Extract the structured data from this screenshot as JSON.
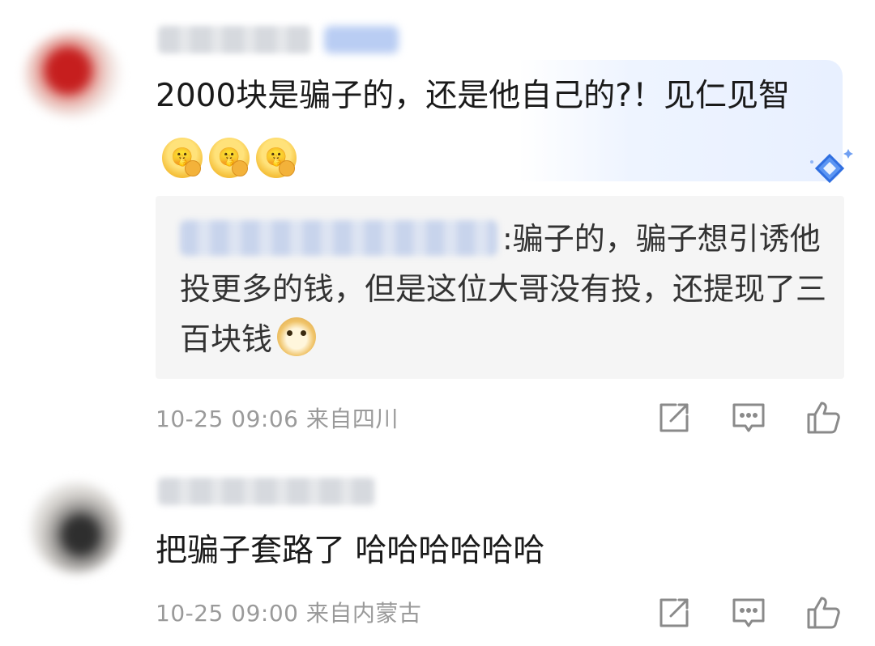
{
  "comments": [
    {
      "username": "",
      "text_main": "2000块是骗子的，还是他自己的?！见仁见智",
      "emojis": [
        "shush-emoji",
        "shush-emoji",
        "shush-emoji"
      ],
      "reply": {
        "author": "",
        "text": ":骗子的，骗子想引诱他投更多的钱，但是这位大哥没有投，还提现了三百块钱",
        "emoji": "doge-emoji"
      },
      "timestamp": "10-25 09:06",
      "location": "来自四川"
    },
    {
      "username": "",
      "text_main": "把骗子套路了 哈哈哈哈哈哈",
      "timestamp": "10-25 09:00",
      "location": "来自内蒙古"
    }
  ],
  "colors": {
    "meta_gray": "#9a9a9a",
    "quote_bg": "#f5f5f5",
    "vip_accent": "#4f8ff7"
  },
  "icons": {
    "share": "share-icon",
    "comment": "comment-icon",
    "like": "thumbs-up-icon",
    "vip": "vip-diamond-icon"
  }
}
